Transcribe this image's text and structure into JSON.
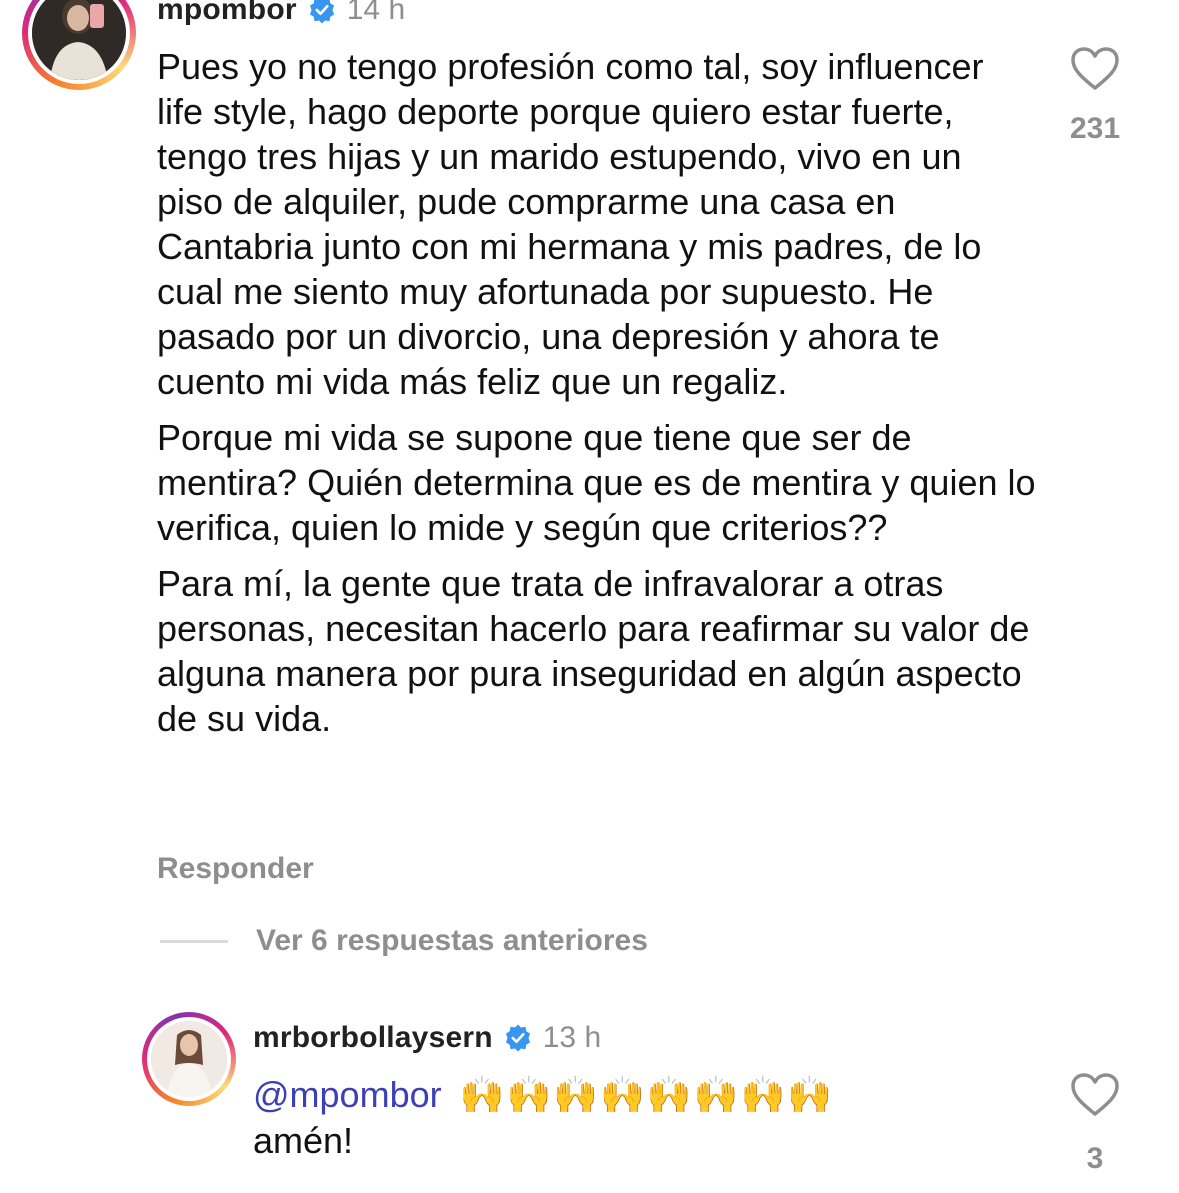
{
  "comment1": {
    "username": "mpombor",
    "time": "14 h",
    "paragraphs": [
      "Pues yo no tengo profesión como tal, soy influencer life style, hago deporte porque quiero estar fuerte, tengo tres hijas y un marido estupendo, vivo en un piso de alquiler, pude comprarme una casa en Cantabria junto con mi hermana y mis padres, de lo cual me siento muy afortunada por supuesto. He pasado por un divorcio, una depresión y ahora te cuento mi vida más feliz que un regaliz.",
      "Porque mi vida se supone que tiene que ser de mentira? Quién determina que es de mentira y quien lo verifica, quien lo mide y según que criterios??",
      "Para mí, la gente que trata de infravalorar a otras personas, necesitan hacerlo para reafirmar su valor de alguna manera por pura inseguridad en algún aspecto de su vida."
    ],
    "reply_label": "Responder",
    "like_count": "231",
    "like_icon": "heart-outline-icon"
  },
  "view_replies": {
    "label": "Ver 6 respuestas anteriores"
  },
  "comment2": {
    "username": "mrborbollaysern",
    "time": "13 h",
    "mention": "@mpombor",
    "emojis": "🙌🙌🙌🙌🙌🙌🙌🙌",
    "text_line2": "amén!",
    "like_count": "3",
    "like_icon": "heart-outline-icon"
  },
  "colors": {
    "verified_blue": "#3797f0",
    "mention": "#3d3fb5",
    "muted_text": "#8e8e8e"
  }
}
